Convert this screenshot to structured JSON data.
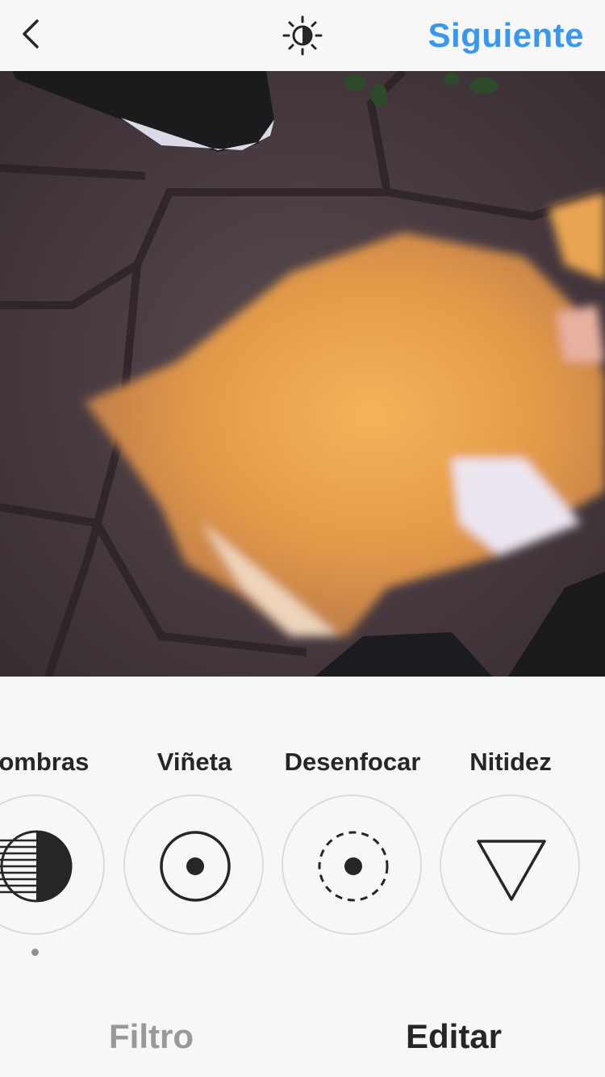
{
  "header": {
    "back_icon": "chevron-left-icon",
    "lux_icon": "lux-brightness-icon",
    "next_label": "Siguiente",
    "next_color": "#3897f0"
  },
  "photo": {
    "subject": "orange kitten photo"
  },
  "tools": [
    {
      "label": "Sombras",
      "icon": "shadows-icon",
      "active": true
    },
    {
      "label": "Viñeta",
      "icon": "vignette-icon",
      "active": false
    },
    {
      "label": "Desenfocar",
      "icon": "tilt-shift-icon",
      "active": false
    },
    {
      "label": "Nitidez",
      "icon": "sharpen-icon",
      "active": false
    }
  ],
  "tabs": {
    "filter_label": "Filtro",
    "edit_label": "Editar",
    "active": "Editar"
  }
}
